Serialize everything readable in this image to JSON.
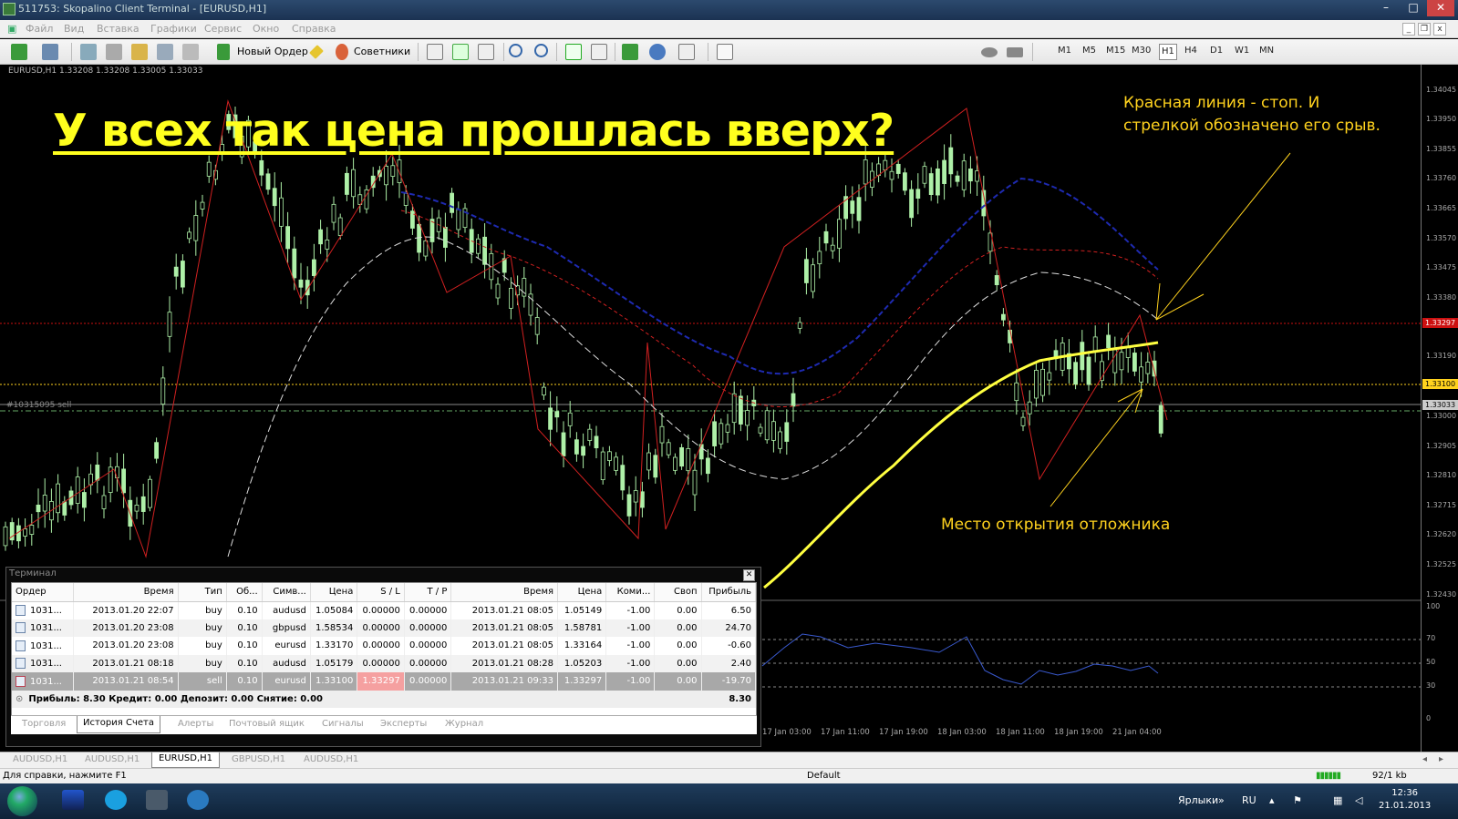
{
  "window": {
    "title": "511753: Skopalino Client Terminal - [EURUSD,H1]"
  },
  "menu": [
    "Файл",
    "Вид",
    "Вставка",
    "Графики",
    "Сервис",
    "Окно",
    "Справка"
  ],
  "toolbar": {
    "new_order": "Новый Ордер",
    "advisors": "Советники",
    "timeframes": [
      "M1",
      "M5",
      "M15",
      "M30",
      "H1",
      "H4",
      "D1",
      "W1",
      "MN"
    ],
    "active_timeframe": "H1"
  },
  "chart": {
    "info": "EURUSD,H1  1.33208 1.33208 1.33005 1.33033",
    "big_title": "У всех так цена прошлась вверх?",
    "annotation_stop": "Красная линия - стоп. И стрелкой обозначено его срыв.",
    "annotation_pending": "Место открытия отложника",
    "order_label": "#10315095 sell",
    "price_labels": [
      "1.34045",
      "1.33950",
      "1.33855",
      "1.33760",
      "1.33665",
      "1.33570",
      "1.33475",
      "1.33380",
      "1.33190",
      "1.33000",
      "1.32905",
      "1.32810",
      "1.32715",
      "1.32620",
      "1.32525",
      "1.32430"
    ],
    "stop_price": "1.33297",
    "order_price": "1.33100",
    "current_price": "1.33033",
    "indicator_levels": [
      "100",
      "70",
      "50",
      "30",
      "0"
    ],
    "time_labels": [
      "17 Jan 03:00",
      "17 Jan 11:00",
      "17 Jan 19:00",
      "18 Jan 03:00",
      "18 Jan 11:00",
      "18 Jan 19:00",
      "21 Jan 04:00"
    ]
  },
  "terminal": {
    "title": "Терминал",
    "columns": [
      "Ордер",
      "Время",
      "Тип",
      "Об...",
      "Симв...",
      "Цена",
      "S / L",
      "T / P",
      "Время",
      "Цена",
      "Коми...",
      "Своп",
      "Прибыль"
    ],
    "rows": [
      {
        "order": "1031...",
        "open_time": "2013.01.20 22:07",
        "type": "buy",
        "volume": "0.10",
        "symbol": "audusd",
        "price": "1.05084",
        "sl": "0.00000",
        "tp": "0.00000",
        "close_time": "2013.01.21 08:05",
        "close_price": "1.05149",
        "commission": "-1.00",
        "swap": "0.00",
        "profit": "6.50"
      },
      {
        "order": "1031...",
        "open_time": "2013.01.20 23:08",
        "type": "buy",
        "volume": "0.10",
        "symbol": "gbpusd",
        "price": "1.58534",
        "sl": "0.00000",
        "tp": "0.00000",
        "close_time": "2013.01.21 08:05",
        "close_price": "1.58781",
        "commission": "-1.00",
        "swap": "0.00",
        "profit": "24.70"
      },
      {
        "order": "1031...",
        "open_time": "2013.01.20 23:08",
        "type": "buy",
        "volume": "0.10",
        "symbol": "eurusd",
        "price": "1.33170",
        "sl": "0.00000",
        "tp": "0.00000",
        "close_time": "2013.01.21 08:05",
        "close_price": "1.33164",
        "commission": "-1.00",
        "swap": "0.00",
        "profit": "-0.60"
      },
      {
        "order": "1031...",
        "open_time": "2013.01.21 08:18",
        "type": "buy",
        "volume": "0.10",
        "symbol": "audusd",
        "price": "1.05179",
        "sl": "0.00000",
        "tp": "0.00000",
        "close_time": "2013.01.21 08:28",
        "close_price": "1.05203",
        "commission": "-1.00",
        "swap": "0.00",
        "profit": "2.40"
      },
      {
        "order": "1031...",
        "open_time": "2013.01.21 08:54",
        "type": "sell",
        "volume": "0.10",
        "symbol": "eurusd",
        "price": "1.33100",
        "sl": "1.33297",
        "tp": "0.00000",
        "close_time": "2013.01.21 09:33",
        "close_price": "1.33297",
        "commission": "-1.00",
        "swap": "0.00",
        "profit": "-19.70"
      }
    ],
    "summary": "Прибыль: 8.30  Кредит: 0.00  Депозит: 0.00  Снятие: 0.00",
    "summary_total": "8.30",
    "tabs": [
      "Торговля",
      "История Счета",
      "Алерты",
      "Почтовый ящик",
      "Сигналы",
      "Эксперты",
      "Журнал"
    ],
    "active_tab": "История Счета"
  },
  "chart_tabs": [
    "AUDUSD,H1",
    "AUDUSD,H1",
    "EURUSD,H1",
    "GBPUSD,H1",
    "AUDUSD,H1"
  ],
  "active_chart_tab": "EURUSD,H1",
  "status": {
    "help": "Для справки, нажмите F1",
    "profile": "Default",
    "traffic": "92/1 kb"
  },
  "taskbar": {
    "label": "Ярлыки",
    "lang": "RU",
    "time": "12:36",
    "date": "21.01.2013"
  },
  "colors": {
    "yellow_text": "#ffff1e",
    "annot": "#ffd21e",
    "stop_line": "#cc1111",
    "candle": "#aef0a8"
  }
}
